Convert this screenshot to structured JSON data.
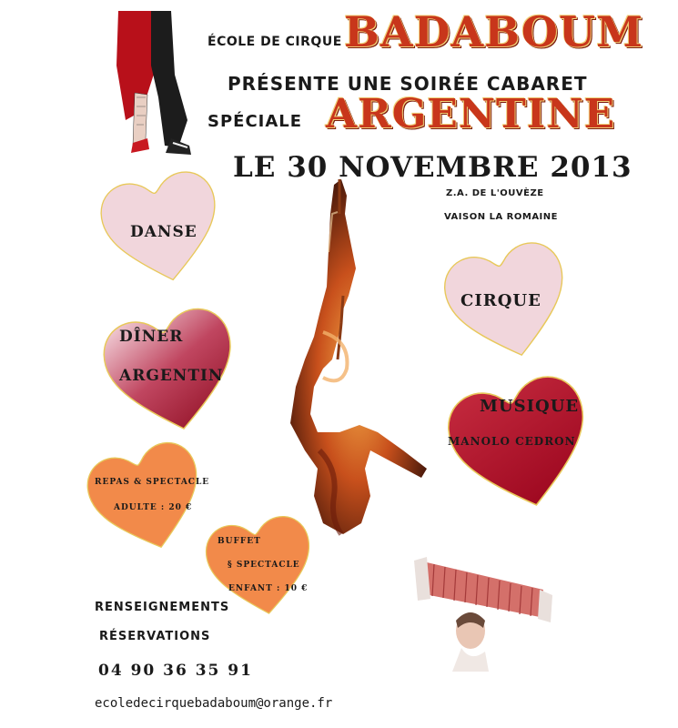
{
  "header": {
    "ecole": "ÉCOLE DE CIRQUE",
    "badaboum": "BADABOUM",
    "presente": "PRÉSENTE UNE SOIRÉE CABARET",
    "speciale": "SPÉCIALE",
    "argentine": "ARGENTINE",
    "date": "LE 30 NOVEMBRE 2013"
  },
  "location": {
    "line1": "Z.A. DE L'OUVÈZE",
    "line2": "VAISON LA ROMAINE"
  },
  "hearts": {
    "danse": "DANSE",
    "cirque": "CIRQUE",
    "diner_line1": "DÎNER",
    "diner_line2": "ARGENTIN",
    "musique": "MUSIQUE",
    "musique_artist": "MANOLO CEDRON",
    "repas_line1": "REPAS & SPECTACLE",
    "repas_line2": "ADULTE : 20 €",
    "buffet_line1": "BUFFET",
    "buffet_line2": "§ SPECTACLE",
    "buffet_line3": "ENFANT : 10 €"
  },
  "contact": {
    "renseignements": "RENSEIGNEMENTS",
    "reservations": "RÉSERVATIONS",
    "phone": "04 90 36 35 91",
    "email": "ecoledecirquebadaboum@orange.fr"
  },
  "colors": {
    "title_red": "#c8361b",
    "heart_pink": "#f1d6dc",
    "heart_rose": "#c04660",
    "heart_wine": "#b0102a",
    "heart_orange": "#f28a4a",
    "heart_outline": "#e8c85a"
  }
}
